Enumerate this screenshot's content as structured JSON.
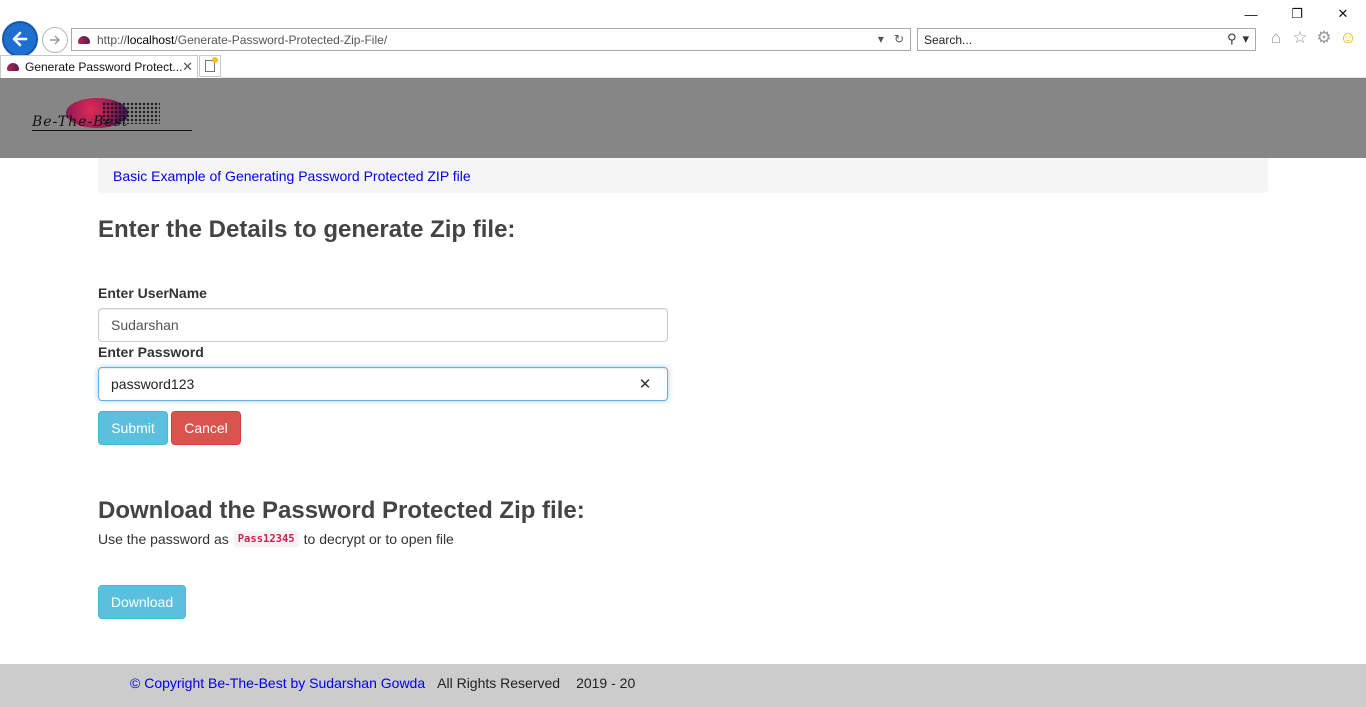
{
  "browser": {
    "url_prefix": "http://",
    "url_host": "localhost",
    "url_path": "/Generate-Password-Protected-Zip-File/",
    "search_placeholder": "Search...",
    "tab_title": "Generate Password Protect...",
    "window_buttons": [
      "minimize",
      "restore",
      "close"
    ]
  },
  "header": {
    "logo_text": "Be-The-Best"
  },
  "breadcrumb": {
    "link": "Basic Example of Generating Password Protected ZIP file"
  },
  "form": {
    "heading": "Enter the Details to generate Zip file:",
    "username_label": "Enter UserName",
    "username_value": "Sudarshan",
    "password_label": "Enter Password",
    "password_value": "password123",
    "submit_label": "Submit",
    "cancel_label": "Cancel"
  },
  "download": {
    "heading": "Download the Password Protected Zip file:",
    "hint_before": "Use the password as",
    "password_code": "Pass12345",
    "hint_after": "to decrypt or to open file",
    "button_label": "Download"
  },
  "footer": {
    "copyright": "© Copyright Be-The-Best by Sudarshan Gowda",
    "rights": "All Rights Reserved",
    "years": "2019 - 20"
  },
  "colors": {
    "header_bg": "#868686",
    "info_button": "#5bc0de",
    "danger_button": "#d9534f",
    "footer_bg": "#cccccc",
    "link": "#0000ee"
  }
}
